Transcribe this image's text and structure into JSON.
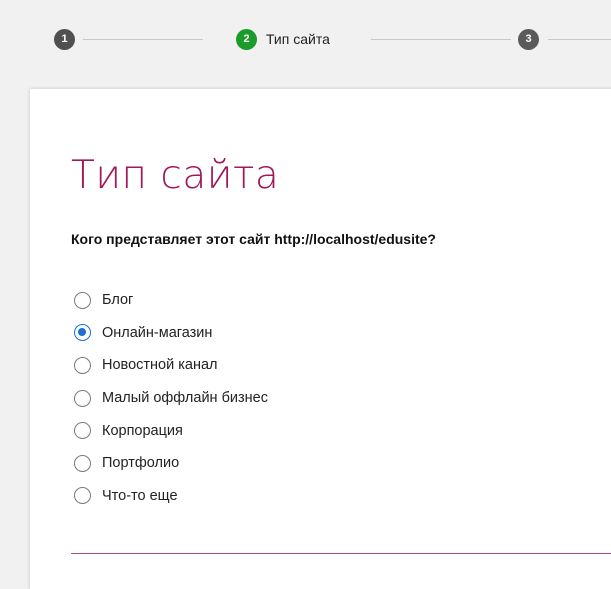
{
  "stepper": {
    "steps": [
      {
        "number": "1",
        "label": ""
      },
      {
        "number": "2",
        "label": "Тип сайта"
      },
      {
        "number": "3",
        "label": ""
      }
    ]
  },
  "page": {
    "title": "Тип сайта",
    "question": "Кого представляет этот сайт http://localhost/edusite?"
  },
  "options": [
    {
      "label": "Блог",
      "checked": false
    },
    {
      "label": "Онлайн-магазин",
      "checked": true
    },
    {
      "label": "Новостной канал",
      "checked": false
    },
    {
      "label": "Малый оффлайн бизнес",
      "checked": false
    },
    {
      "label": "Корпорация",
      "checked": false
    },
    {
      "label": "Портфолио",
      "checked": false
    },
    {
      "label": "Что-то еще",
      "checked": false
    }
  ],
  "colors": {
    "title": "#a0185a",
    "current_step": "#1a9b2a",
    "radio_selected": "#1e6fd0"
  }
}
